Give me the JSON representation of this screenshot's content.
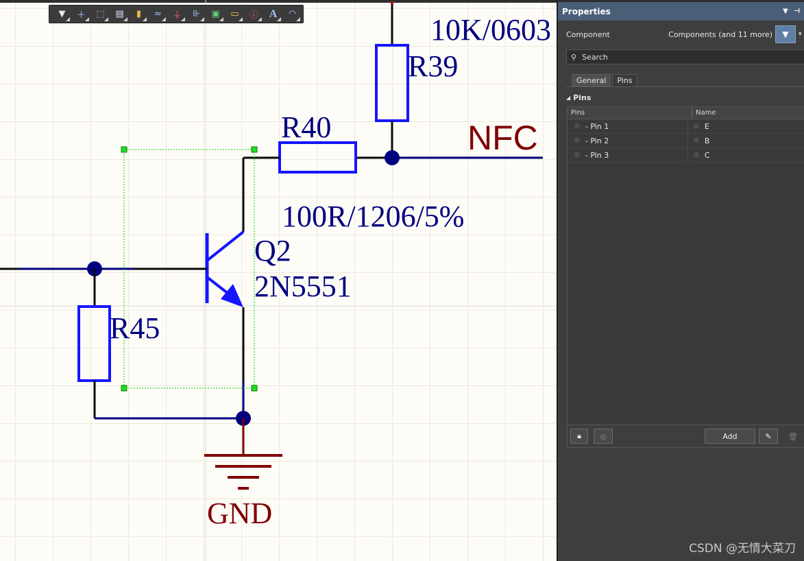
{
  "schematic": {
    "labels": {
      "r39_value": "10K/0603",
      "r39": "R39",
      "r40": "R40",
      "net_nfc": "NFC",
      "r40_value": "100R/1206/5%",
      "q2": "Q2",
      "q2_part": "2N5551",
      "r45": "R45",
      "gnd": "GND"
    },
    "colors": {
      "wire": "#0a0a0a",
      "net_wire": "#00007f",
      "component": "#1515ff",
      "label": "#000080",
      "power": "#800000",
      "selection": "#00d400"
    }
  },
  "toolbar": {
    "icons": [
      "filter-icon",
      "crosshair-icon",
      "select-rect-icon",
      "align-icon",
      "part-icon",
      "wire-icon",
      "power-icon",
      "bus-icon",
      "sheet-icon",
      "port-icon",
      "directive-icon",
      "text-icon",
      "arc-icon"
    ]
  },
  "panel": {
    "title": "Properties",
    "component_label": "Component",
    "components_filter": "Components (and 11 more)",
    "search_placeholder": "Search",
    "tabs": [
      "General",
      "Pins"
    ],
    "active_tab": "Pins",
    "section": "Pins",
    "columns": [
      "Pins",
      "Name"
    ],
    "rows": [
      {
        "pin": "- Pin 1",
        "name": "E"
      },
      {
        "pin": "- Pin 2",
        "name": "B"
      },
      {
        "pin": "- Pin 3",
        "name": "C"
      }
    ],
    "add_button": "Add"
  },
  "watermark": "CSDN @无情大菜刀"
}
